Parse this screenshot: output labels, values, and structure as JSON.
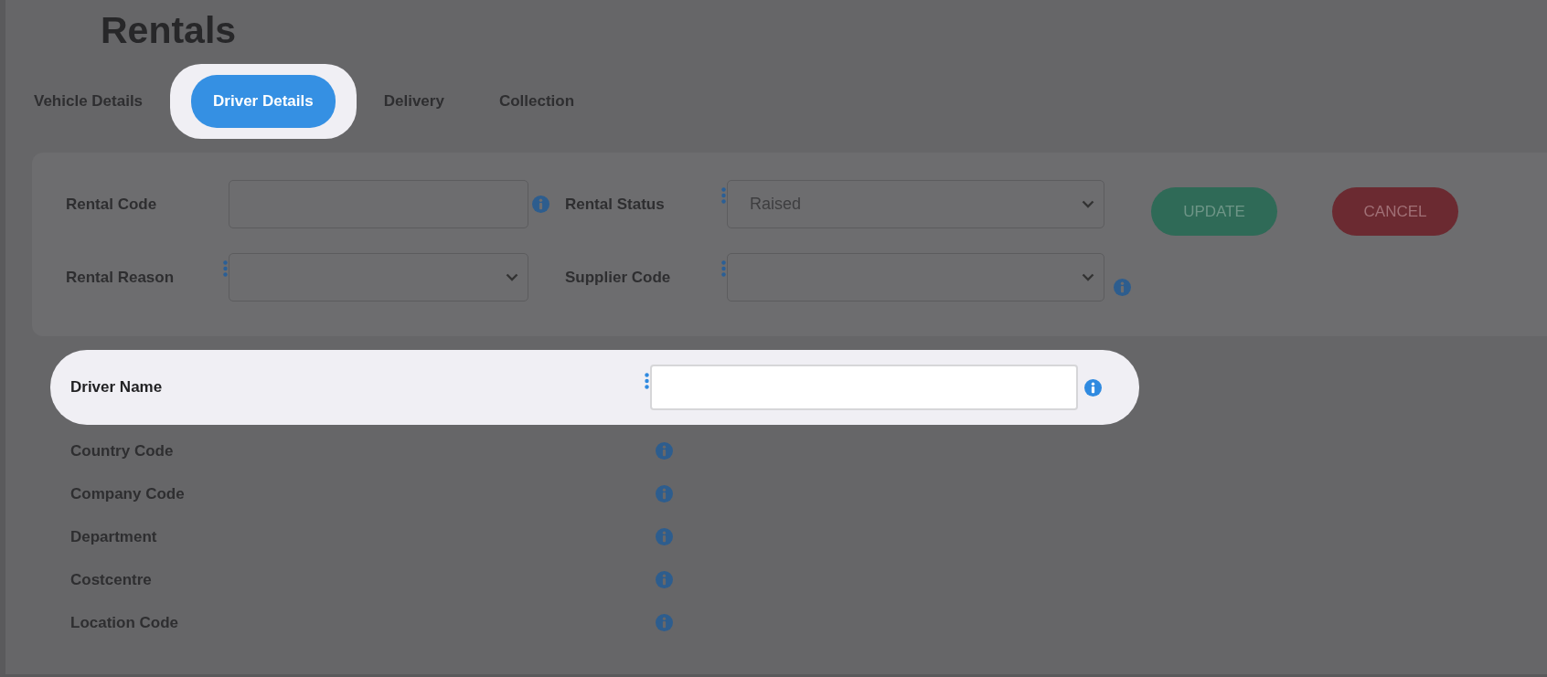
{
  "page": {
    "title": "Rentals"
  },
  "tabs": [
    {
      "label": "Vehicle Details",
      "selected": false,
      "highlighted": false
    },
    {
      "label": "Driver Details",
      "selected": true,
      "highlighted": true
    },
    {
      "label": "Delivery",
      "selected": false,
      "highlighted": false
    },
    {
      "label": "Collection",
      "selected": false,
      "highlighted": false
    }
  ],
  "rental_form": {
    "fields": [
      {
        "label": "Rental Code",
        "kind": "input",
        "required": false,
        "info": true
      },
      {
        "label": "Rental Status",
        "kind": "select",
        "value": "Raised",
        "required": true,
        "info": false
      },
      {
        "label": "Rental Reason",
        "kind": "select",
        "required": true,
        "info": false
      },
      {
        "label": "Supplier Code",
        "kind": "select",
        "required": true,
        "info": true
      }
    ],
    "buttons": [
      {
        "label": "UPDATE",
        "kind": "primary"
      },
      {
        "label": "CANCEL",
        "kind": "danger"
      }
    ]
  },
  "driver_fields": [
    {
      "label": "Driver Name",
      "kind": "input",
      "required": true,
      "info": true,
      "highlighted": true
    },
    {
      "label": "Country Code",
      "kind": "text",
      "required": false,
      "info": true,
      "highlighted": false
    },
    {
      "label": "Company Code",
      "kind": "text",
      "required": false,
      "info": true,
      "highlighted": false
    },
    {
      "label": "Department",
      "kind": "text",
      "required": false,
      "info": true,
      "highlighted": false
    },
    {
      "label": "Costcentre",
      "kind": "text",
      "required": false,
      "info": true,
      "highlighted": false
    },
    {
      "label": "Location Code",
      "kind": "text",
      "required": false,
      "info": true,
      "highlighted": false
    }
  ]
}
